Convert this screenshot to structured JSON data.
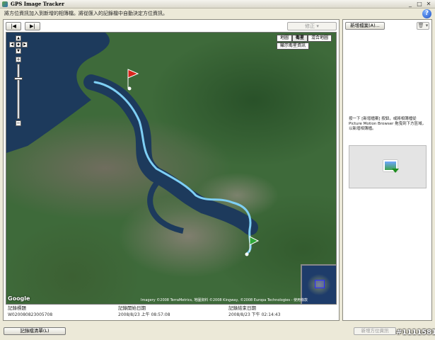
{
  "window": {
    "title": "GPS Image Tracker"
  },
  "instruction": "將方位資訊加入到新增的相簿檔。將從匯入的記錄檔中自動決定方位資訊。",
  "help_label": "?",
  "toolbar": {
    "prev_label": "|◀",
    "next_label": "▶|",
    "correct_label": "修正  ▾"
  },
  "map": {
    "types": [
      "地圖",
      "衛星",
      "混合地圖"
    ],
    "active_type": "衛星",
    "terrain_label": "顯示衛星資訊",
    "zoom_level": 0.25,
    "logo": "Google",
    "attribution": "Imagery ©2008 TerraMetrics, 地圖資料 ©2008 Kingway, ©2008 Europa Technologies - 使用條款",
    "track_color": "#7ecff5",
    "water_color": "#1d3a5c"
  },
  "track_info": {
    "headers": [
      "記錄標題",
      "記錄開始日期",
      "記錄結束日期"
    ],
    "values": [
      "W020080823005708",
      "2008/8/23 上午 08:57:08",
      "2008/8/23 下午 02:14:43"
    ]
  },
  "right_panel": {
    "add_folder_label": "新增檔案(A)...",
    "trash_label": "🗑 ▾",
    "hint": "按一下 [新增檔案] 按鈕，或將相簿檔從 Picture Motion Browser 拖曳到下方區域，以新增相簿檔。"
  },
  "footer": {
    "track_list_label": "記錄檔清單(L)",
    "add_location_label": "新增方位資訊"
  },
  "watermark": "#1111581"
}
